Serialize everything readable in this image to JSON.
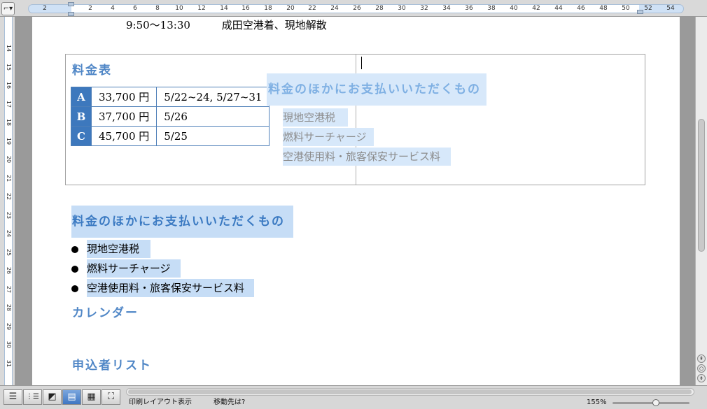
{
  "ruler": {
    "tab_selector": "⌐▾",
    "h_ticks": [
      "2",
      "2",
      "4",
      "6",
      "8",
      "10",
      "12",
      "14",
      "16",
      "18",
      "20",
      "22",
      "24",
      "26",
      "28",
      "30",
      "32",
      "34",
      "36",
      "38",
      "40",
      "42",
      "44",
      "46",
      "48",
      "50",
      "52",
      "54"
    ],
    "v_ticks": [
      "14",
      "15",
      "16",
      "17",
      "18",
      "19",
      "20",
      "21",
      "22",
      "23",
      "24",
      "25",
      "26",
      "27",
      "28",
      "29",
      "30",
      "31"
    ]
  },
  "document": {
    "itinerary_time": "9:50〜13:30",
    "itinerary_note": "成田空港着、現地解散",
    "fare_heading": "料金表",
    "fare_table": [
      {
        "class": "A",
        "price": "33,700 円",
        "dates": "5/22~24, 5/27~31"
      },
      {
        "class": "B",
        "price": "37,700 円",
        "dates": "5/26"
      },
      {
        "class": "C",
        "price": "45,700 円",
        "dates": "5/25"
      }
    ],
    "extra_heading_box": "料金のほかにお支払いいただくもの",
    "extra_items_box": [
      "現地空港税",
      "燃料サーチャージ",
      "空港使用料・旅客保安サービス料"
    ],
    "extra_heading": "料金のほかにお支払いいただくもの",
    "extra_items": [
      "現地空港税",
      "燃料サーチャージ",
      "空港使用料・旅客保安サービス料"
    ],
    "calendar_heading": "カレンダー",
    "applicants_heading": "申込者リスト"
  },
  "status_bar": {
    "view_mode": "印刷レイアウト表示",
    "goto": "移動先は?",
    "zoom": "155%"
  },
  "view_buttons": [
    {
      "name": "draft-view-button",
      "glyph": "☰"
    },
    {
      "name": "outline-view-button",
      "glyph": "⋮☰"
    },
    {
      "name": "publishing-view-button",
      "glyph": "◩"
    },
    {
      "name": "print-layout-view-button",
      "glyph": "▤"
    },
    {
      "name": "notebook-view-button",
      "glyph": "▦"
    },
    {
      "name": "full-screen-view-button",
      "glyph": "⛶"
    }
  ],
  "scroll_nav": {
    "prev": "⇞",
    "select": "○",
    "next": "⇟"
  }
}
